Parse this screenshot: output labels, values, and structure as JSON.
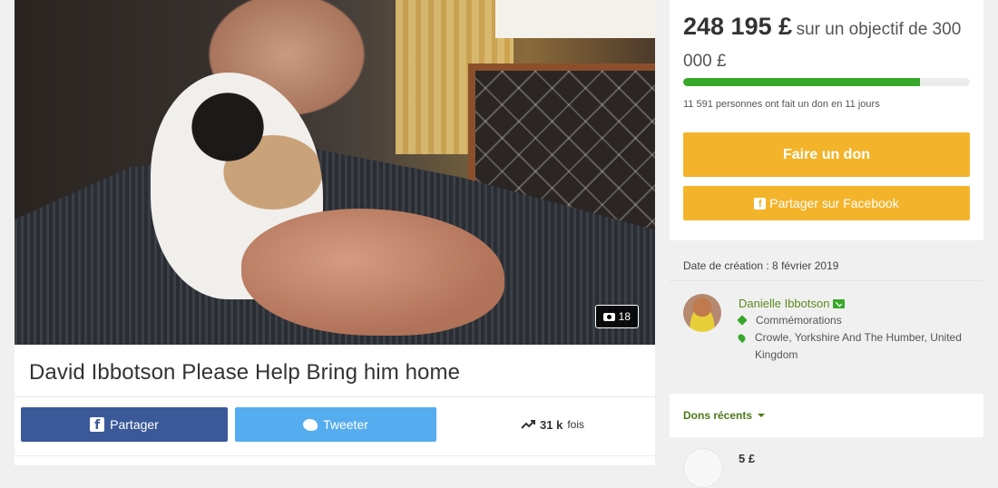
{
  "campaign": {
    "title": "David Ibbotson Please Help Bring him home",
    "photo_count": "18"
  },
  "share": {
    "facebook_label": "Partager",
    "twitter_label": "Tweeter",
    "share_count": "31 k",
    "share_count_suffix": "fois"
  },
  "donation": {
    "raised": "248 195 £",
    "goal_text": "sur un objectif de 300 000 £",
    "progress_fraction": 0.827,
    "donors_text": "11 591 personnes ont fait un don en 11 jours",
    "donate_label": "Faire un don",
    "share_facebook_label": "Partager sur Facebook"
  },
  "meta": {
    "created": "Date de création : 8 février 2019",
    "organizer_name": "Danielle Ibbotson",
    "category": "Commémorations",
    "location": "Crowle, Yorkshire And The Humber, United Kingdom"
  },
  "recent": {
    "label": "Dons récents",
    "first_amount": "5 £"
  },
  "colors": {
    "accent_green": "#37a82a",
    "donate_orange": "#f3b42c",
    "facebook_blue": "#3b5998",
    "twitter_blue": "#55acee"
  }
}
